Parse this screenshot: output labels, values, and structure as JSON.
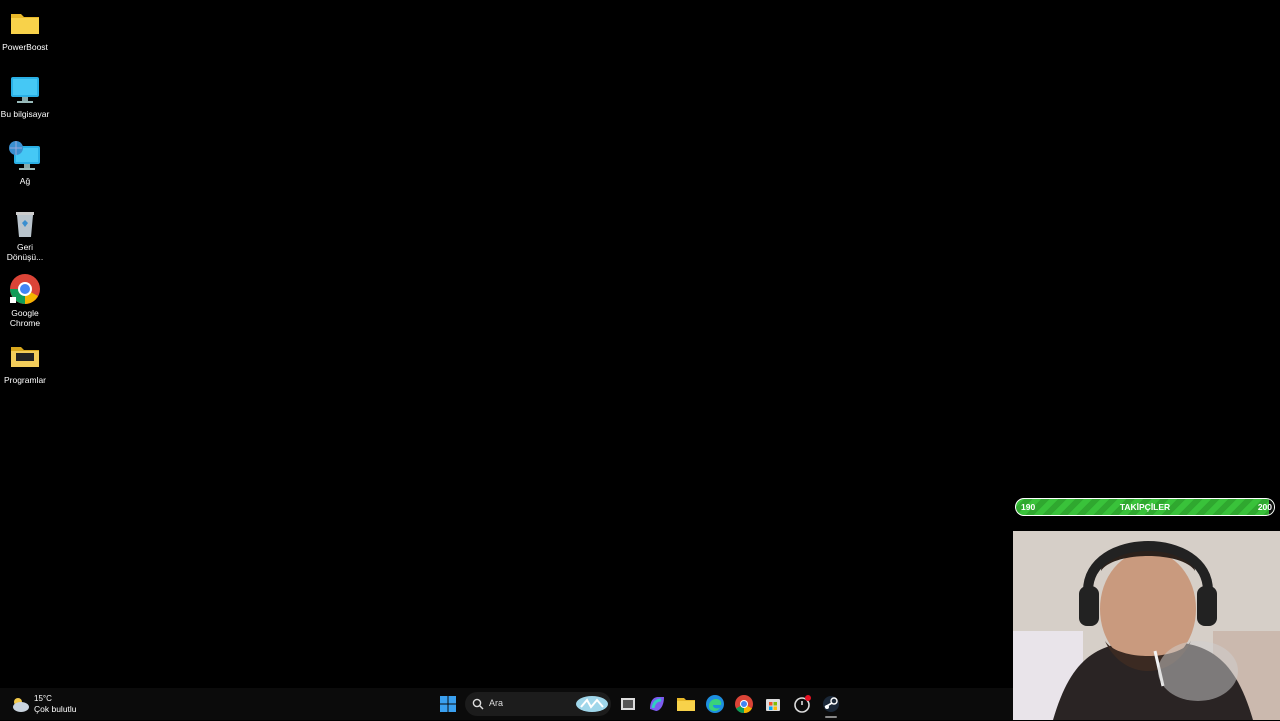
{
  "desktop": {
    "icons": [
      {
        "label": "PowerBoost",
        "icon": "folder-icon"
      },
      {
        "label": "Bu bilgisayar",
        "icon": "computer-icon"
      },
      {
        "label": "Ağ",
        "icon": "network-icon"
      },
      {
        "label": "Geri\nDönüşü...",
        "icon": "recycle-bin-icon"
      },
      {
        "label": "Google\nChrome",
        "icon": "chrome-icon"
      },
      {
        "label": "Programlar",
        "icon": "folder-dark-icon"
      }
    ]
  },
  "overlay": {
    "followers": {
      "label": "TAKİPÇİLER",
      "min": "190",
      "max": "200",
      "progress": 0.98
    }
  },
  "taskbar": {
    "weather": {
      "temp": "15°C",
      "condition": "Çok bulutlu"
    },
    "search": {
      "placeholder": "Ara"
    },
    "apps": [
      "start-icon",
      "search-icon",
      "widget-icon",
      "task-view-icon",
      "copilot-icon",
      "file-explorer-icon",
      "edge-icon",
      "chrome-icon",
      "store-icon",
      "clock-icon",
      "steam-icon"
    ]
  },
  "colors": {
    "bar_green": "#39c23a",
    "taskbar": "#0b0b0b",
    "desktop": "#000000"
  }
}
